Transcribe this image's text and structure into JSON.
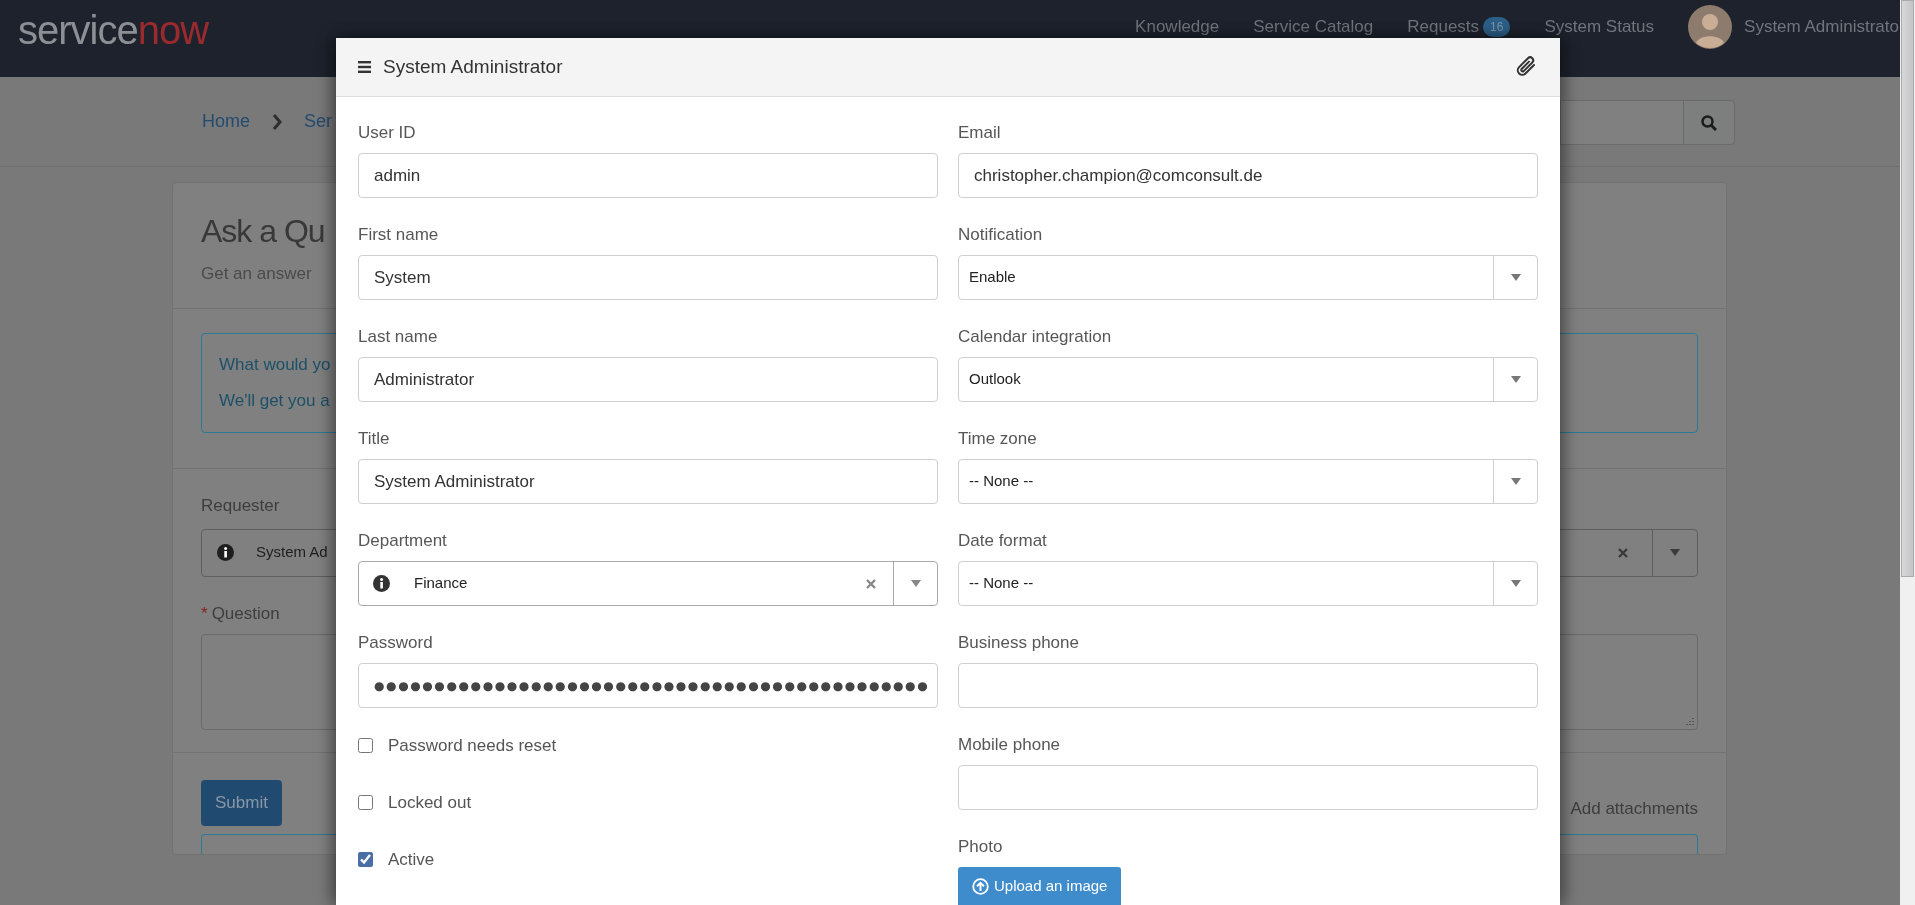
{
  "header": {
    "logo": [
      "service",
      "now"
    ],
    "nav": [
      {
        "label": "Knowledge"
      },
      {
        "label": "Service Catalog"
      },
      {
        "label": "Requests",
        "badge": "16"
      },
      {
        "label": "System Status"
      }
    ],
    "user": "System Administrato"
  },
  "breadcrumb": [
    "Home",
    "Ser"
  ],
  "page": {
    "title": "Ask a Qu",
    "subtitle": "Get an answer",
    "info_lines": [
      "What would yo",
      "We'll get you a"
    ],
    "requester": {
      "label": "Requester",
      "value": "System Ad"
    },
    "question": {
      "label": "Question",
      "required_mark": "*"
    },
    "submit": "Submit",
    "attachments": "Add attachments"
  },
  "modal": {
    "title": "System Administrator",
    "left_fields": [
      {
        "kind": "text",
        "label": "User ID",
        "value": "admin"
      },
      {
        "kind": "text",
        "label": "First name",
        "value": "System"
      },
      {
        "kind": "text",
        "label": "Last name",
        "value": "Administrator"
      },
      {
        "kind": "text",
        "label": "Title",
        "value": "System Administrator"
      },
      {
        "kind": "lookup",
        "label": "Department",
        "value": "Finance"
      },
      {
        "kind": "password",
        "label": "Password",
        "value": "●●●●●●●●●●●●●●●●●●●●●●●●●●●●●●●●●●●●●●●●●●●●●●"
      }
    ],
    "checkboxes": [
      {
        "label": "Password needs reset",
        "checked": false
      },
      {
        "label": "Locked out",
        "checked": false
      },
      {
        "label": "Active",
        "checked": true
      }
    ],
    "right_fields": [
      {
        "kind": "text",
        "label": "Email",
        "value": "christopher.champion@comconsult.de"
      },
      {
        "kind": "select",
        "label": "Notification",
        "value": "Enable"
      },
      {
        "kind": "select",
        "label": "Calendar integration",
        "value": "Outlook"
      },
      {
        "kind": "select",
        "label": "Time zone",
        "value": "-- None --"
      },
      {
        "kind": "select",
        "label": "Date format",
        "value": "-- None --"
      },
      {
        "kind": "text",
        "label": "Business phone"
      },
      {
        "kind": "text",
        "label": "Mobile phone"
      },
      {
        "kind": "upload",
        "label": "Photo",
        "button": "Upload an image"
      }
    ]
  }
}
